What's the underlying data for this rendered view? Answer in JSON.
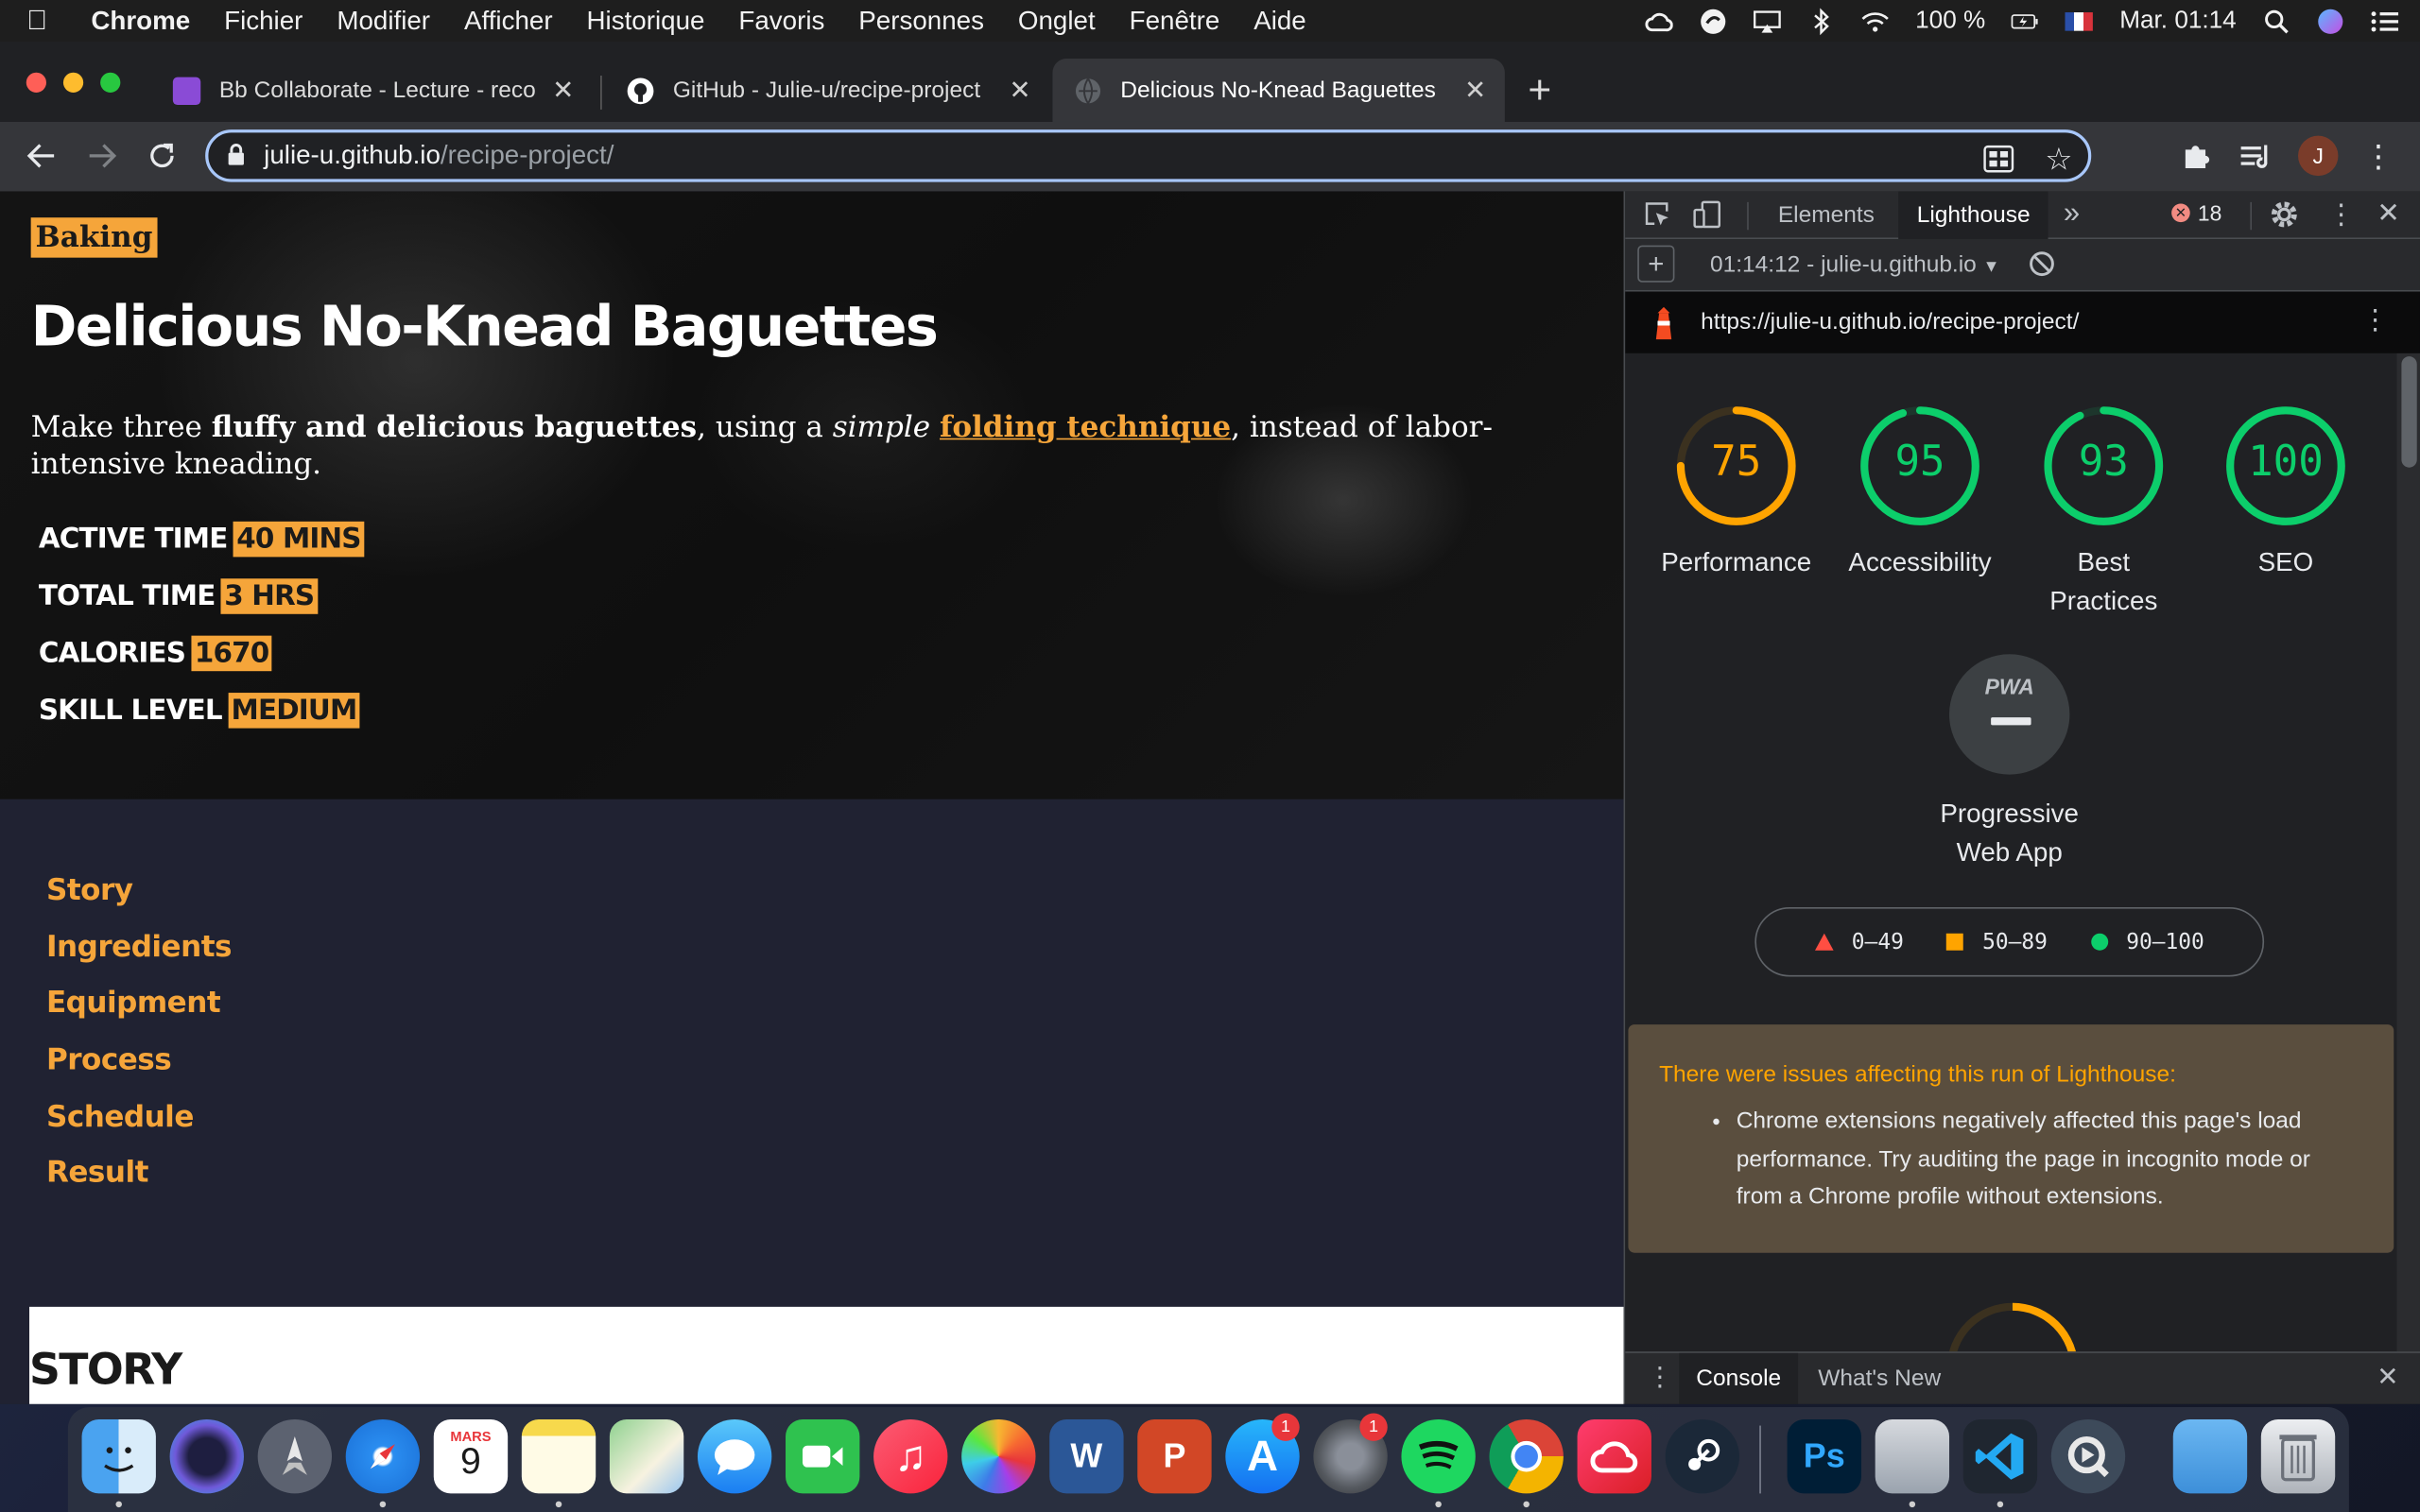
{
  "menubar": {
    "app": "Chrome",
    "items": [
      "Fichier",
      "Modifier",
      "Afficher",
      "Historique",
      "Favoris",
      "Personnes",
      "Onglet",
      "Fenêtre",
      "Aide"
    ],
    "battery": "100 %",
    "clock": "Mar. 01:14"
  },
  "tabs": [
    {
      "title": "Bb Collaborate - Lecture - reco",
      "favicon_color": "#8a4bd6",
      "active": false
    },
    {
      "title": "GitHub - Julie-u/recipe-project",
      "favicon_color": "#ffffff",
      "active": false
    },
    {
      "title": "Delicious No-Knead Baguettes",
      "favicon_color": "#5f6368",
      "active": true
    }
  ],
  "address": {
    "host": "julie-u.github.io",
    "path": "/recipe-project/"
  },
  "profile_initial": "J",
  "page": {
    "category": "Baking",
    "title": "Delicious No-Knead Baguettes",
    "lede": {
      "part1": "Make three ",
      "bold": "fluffy and delicious baguettes",
      "part2": ", using a ",
      "italic": "simple",
      "space": " ",
      "link": "folding technique",
      "part3": ", instead of labor-intensive kneading."
    },
    "stats": [
      {
        "label": "ACTIVE TIME",
        "value": "40 MINS"
      },
      {
        "label": "TOTAL TIME",
        "value": "3 HRS"
      },
      {
        "label": "CALORIES",
        "value": "1670"
      },
      {
        "label": "SKILL LEVEL",
        "value": "MEDIUM"
      }
    ],
    "toc": [
      "Story",
      "Ingredients",
      "Equipment",
      "Process",
      "Schedule",
      "Result"
    ],
    "section_heading": "STORY"
  },
  "devtools": {
    "tabs": {
      "elements": "Elements",
      "lighthouse": "Lighthouse"
    },
    "error_count": "18",
    "report_select": "01:14:12 - julie-u.github.io",
    "report_url": "https://julie-u.github.io/recipe-project/",
    "scores": [
      {
        "label": "Performance",
        "value": 75,
        "color": "#ffa400"
      },
      {
        "label": "Accessibility",
        "value": 95,
        "color": "#0cce6b"
      },
      {
        "label": "Best Practices",
        "value": 93,
        "color": "#0cce6b"
      },
      {
        "label": "SEO",
        "value": 100,
        "color": "#0cce6b"
      }
    ],
    "pwa": {
      "badge": "PWA",
      "label": "Progressive Web App"
    },
    "legend": [
      {
        "range": "0–49",
        "shape": "triangle",
        "color": "#ff4e42"
      },
      {
        "range": "50–89",
        "shape": "square",
        "color": "#ffa400"
      },
      {
        "range": "90–100",
        "shape": "circle",
        "color": "#0cce6b"
      }
    ],
    "warning": {
      "title": "There were issues affecting this run of Lighthouse:",
      "item": "Chrome extensions negatively affected this page's load performance. Try auditing the page in incognito mode or from a Chrome profile without extensions."
    },
    "drawer": {
      "console": "Console",
      "whats_new": "What's New"
    }
  },
  "dock": {
    "calendar": {
      "month": "MARS",
      "day": "9"
    },
    "badges": {
      "app_store": "1",
      "system_prefs": "1"
    },
    "word_letter": "W",
    "powerpoint_letter": "P",
    "photoshop_label": "Ps"
  }
}
